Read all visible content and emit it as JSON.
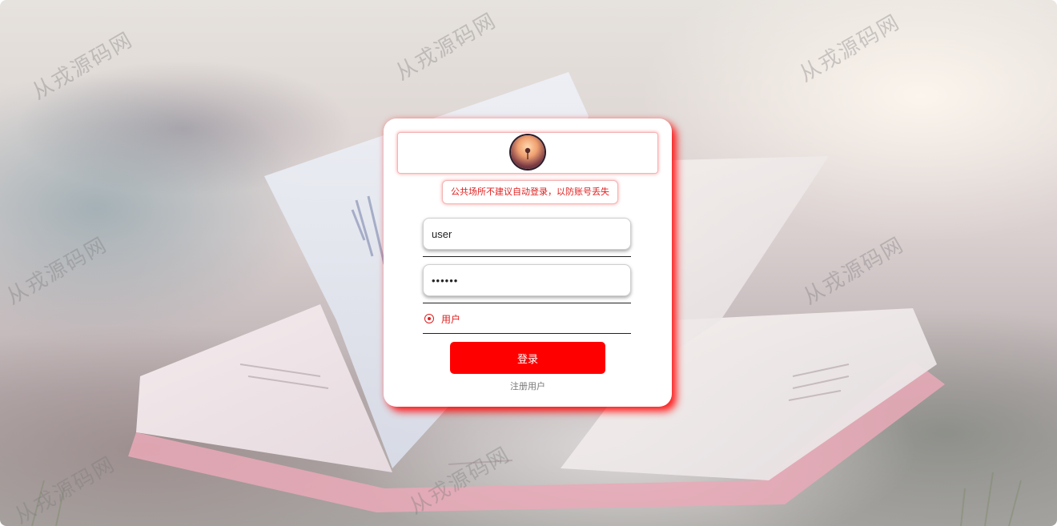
{
  "login": {
    "notice": "公共场所不建议自动登录，以防账号丢失",
    "username_value": "user",
    "password_value": "••••••",
    "role_option": "用户",
    "login_button": "登录",
    "register_link": "注册用户"
  },
  "watermark": {
    "text": "从戎源码网"
  },
  "colors": {
    "accent": "#ff0000",
    "notice_text": "#e02020",
    "card_bg": "#ffffff"
  },
  "icons": {
    "avatar": "avatar-image",
    "radio": "radio-checked-icon"
  }
}
